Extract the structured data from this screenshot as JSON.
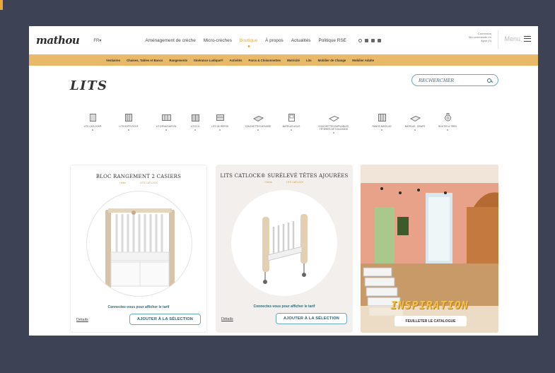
{
  "brand": {
    "logo_text": "mathou",
    "lang": "FR▾"
  },
  "nav": {
    "items": [
      "Aménagement de crèche",
      "Micro-crèches",
      "Boutique",
      "À propos",
      "Actualités",
      "Politique RSE"
    ],
    "active": "Boutique"
  },
  "account": {
    "line1": "Connexion",
    "line2": "Ma commande en",
    "line3": "ligne (0)"
  },
  "menu_label": "Menu",
  "categories": [
    "Vestiaires",
    "Chaises, Tables et Bancs",
    "Rangements",
    "Itinérance Ludique®",
    "Activités",
    "Parcs & Cloisonnettes",
    "Motricité",
    "Lits",
    "Mobilier de Change",
    "Mobilier Adulte"
  ],
  "page": {
    "title": "LITS",
    "search_placeholder": "RECHERCHER"
  },
  "types": [
    {
      "label": "LITS CATLOCK®",
      "icon": "crib-icon"
    },
    {
      "label": "LITS SOFTLOCK®",
      "icon": "crib-soft-icon"
    },
    {
      "label": "LIT D'ÉVACUATION",
      "icon": "evacuation-bed-icon"
    },
    {
      "label": "LIT ECO",
      "icon": "eco-bed-icon"
    },
    {
      "label": "LITS DE REPOS",
      "icon": "rest-bed-icon"
    },
    {
      "label": "COUCHETTES MOUSSE",
      "icon": "foam-cot-icon"
    },
    {
      "label": "MATELAS AGLIS",
      "icon": "mattress-icon"
    },
    {
      "label": "COUCHETTES EMPILABLES, TÊTIÈRES DE COUCHAGE",
      "icon": "stackable-cot-icon"
    },
    {
      "label": "RANGE-MATELAS",
      "icon": "mattress-storage-icon"
    },
    {
      "label": "MATELAS - DRAPS",
      "icon": "sheets-icon"
    },
    {
      "label": "BOUTES À TREN",
      "icon": "pacifier-icon"
    }
  ],
  "products": [
    {
      "title": "BLOC RANGEMENT 2 CASIERS",
      "tag1": "Hêtre",
      "tag2": "LITS CATLOCK",
      "login": "Connectez-vous pour afficher le tarif",
      "details": "Détails",
      "add": "AJOUTER À LA SÉLECTION"
    },
    {
      "title": "LITS CATLOCK® SURÉLEVÉ TÊTES AJOURÉES",
      "tag1": "Chêne",
      "tag2": "LITS CATLOCK",
      "login": "Connectez-vous pour afficher le tarif",
      "details": "Détails",
      "add": "AJOUTER À LA SÉLECTION"
    }
  ],
  "inspiration": {
    "label": "INSPIRATION",
    "button": "FEUILLETER LE CATALOGUE"
  },
  "colors": {
    "accent": "#e9a93a",
    "category_bar": "#e8b968",
    "teal": "#2c6b7a",
    "background": "#3d4354"
  }
}
